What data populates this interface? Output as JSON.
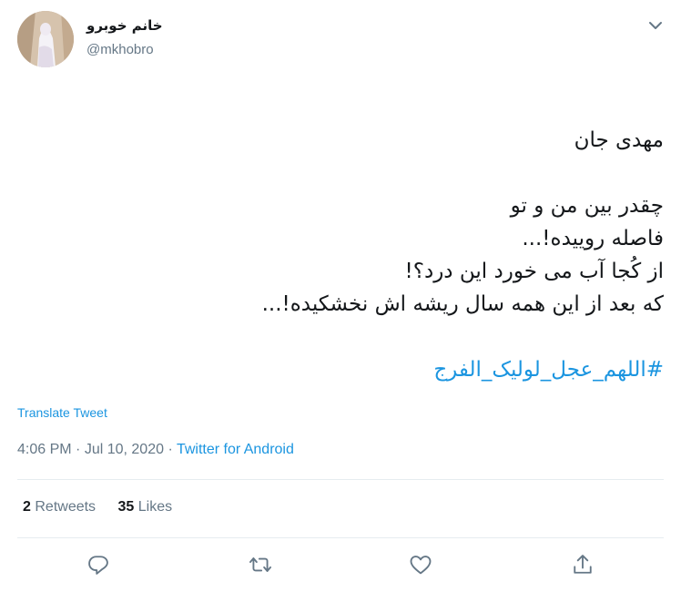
{
  "user": {
    "display_name": "خانم خوبرو",
    "handle": "@mkhobro"
  },
  "tweet": {
    "lines": [
      "مهدی جان",
      "",
      "چقدر بین من و تو",
      "فاصله روییده!...",
      "از کُجا آب می خورد این درد؟!",
      "که بعد از این همه سال ریشه اش نخشکیده!..."
    ],
    "hashtag": "#اللهم_عجل_لولیک_الفرج"
  },
  "translate_label": "Translate Tweet",
  "meta": {
    "time": "4:06 PM",
    "date": "Jul 10, 2020",
    "source": "Twitter for Android"
  },
  "stats": {
    "retweets_count": "2",
    "retweets_label": "Retweets",
    "likes_count": "35",
    "likes_label": "Likes"
  },
  "icons": {
    "caret": "chevron-down-icon",
    "reply": "reply-icon",
    "retweet": "retweet-icon",
    "like": "heart-icon",
    "share": "share-icon"
  },
  "colors": {
    "link": "#1b95e0",
    "secondary": "#657786",
    "text": "#14171a",
    "divider": "#e6ecf0"
  }
}
